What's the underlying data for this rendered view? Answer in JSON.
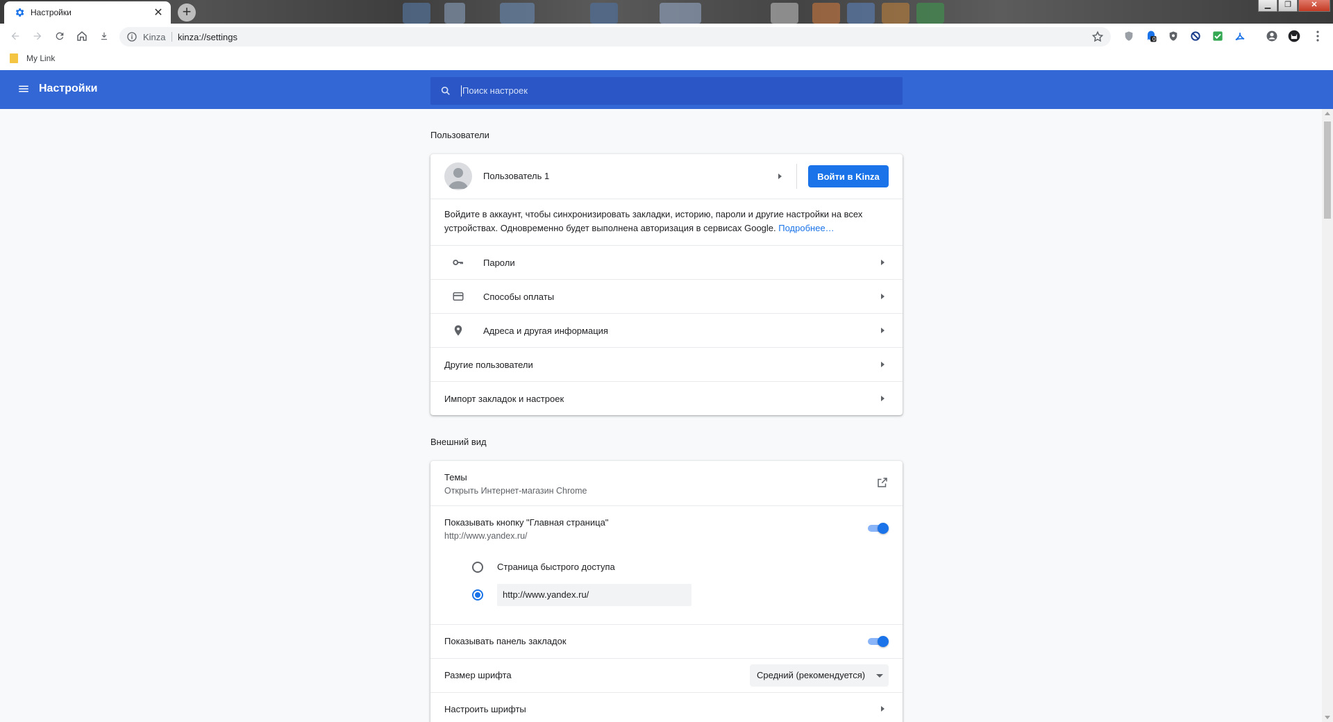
{
  "tab": {
    "title": "Настройки",
    "favicon": "gear-icon"
  },
  "toolbar": {
    "site_name": "Kinza",
    "url": "kinza://settings",
    "ext_badge": "0"
  },
  "bookmarks": {
    "items": [
      {
        "label": "My Link"
      }
    ]
  },
  "header": {
    "title": "Настройки",
    "search_placeholder": "Поиск настроек"
  },
  "users": {
    "section_title": "Пользователи",
    "profile_name": "Пользователь 1",
    "signin_button": "Войти в Kinza",
    "signin_text": "Войдите в аккаунт, чтобы синхронизировать закладки, историю, пароли и другие настройки на всех устройствах. Одновременно будет выполнена авторизация в сервисах Google.",
    "learn_more": "Подробнее…",
    "rows": [
      {
        "label": "Пароли",
        "icon": "key-icon"
      },
      {
        "label": "Способы оплаты",
        "icon": "credit-card-icon"
      },
      {
        "label": "Адреса и другая информация",
        "icon": "location-pin-icon"
      },
      {
        "label": "Другие пользователи"
      },
      {
        "label": "Импорт закладок и настроек"
      }
    ]
  },
  "appearance": {
    "section_title": "Внешний вид",
    "themes_label": "Темы",
    "themes_sub": "Открыть Интернет-магазин Chrome",
    "home_label": "Показывать кнопку \"Главная страница\"",
    "home_sub": "http://www.yandex.ru/",
    "home_enabled": true,
    "radio_new_tab": "Страница быстрого доступа",
    "radio_url_value": "http://www.yandex.ru/",
    "bookmarks_bar_label": "Показывать панель закладок",
    "bookmarks_bar_enabled": true,
    "font_size_label": "Размер шрифта",
    "font_size_value": "Средний (рекомендуется)",
    "customize_fonts_label": "Настроить шрифты"
  },
  "colors": {
    "header": "#3367d6",
    "accent": "#1a73e8"
  }
}
